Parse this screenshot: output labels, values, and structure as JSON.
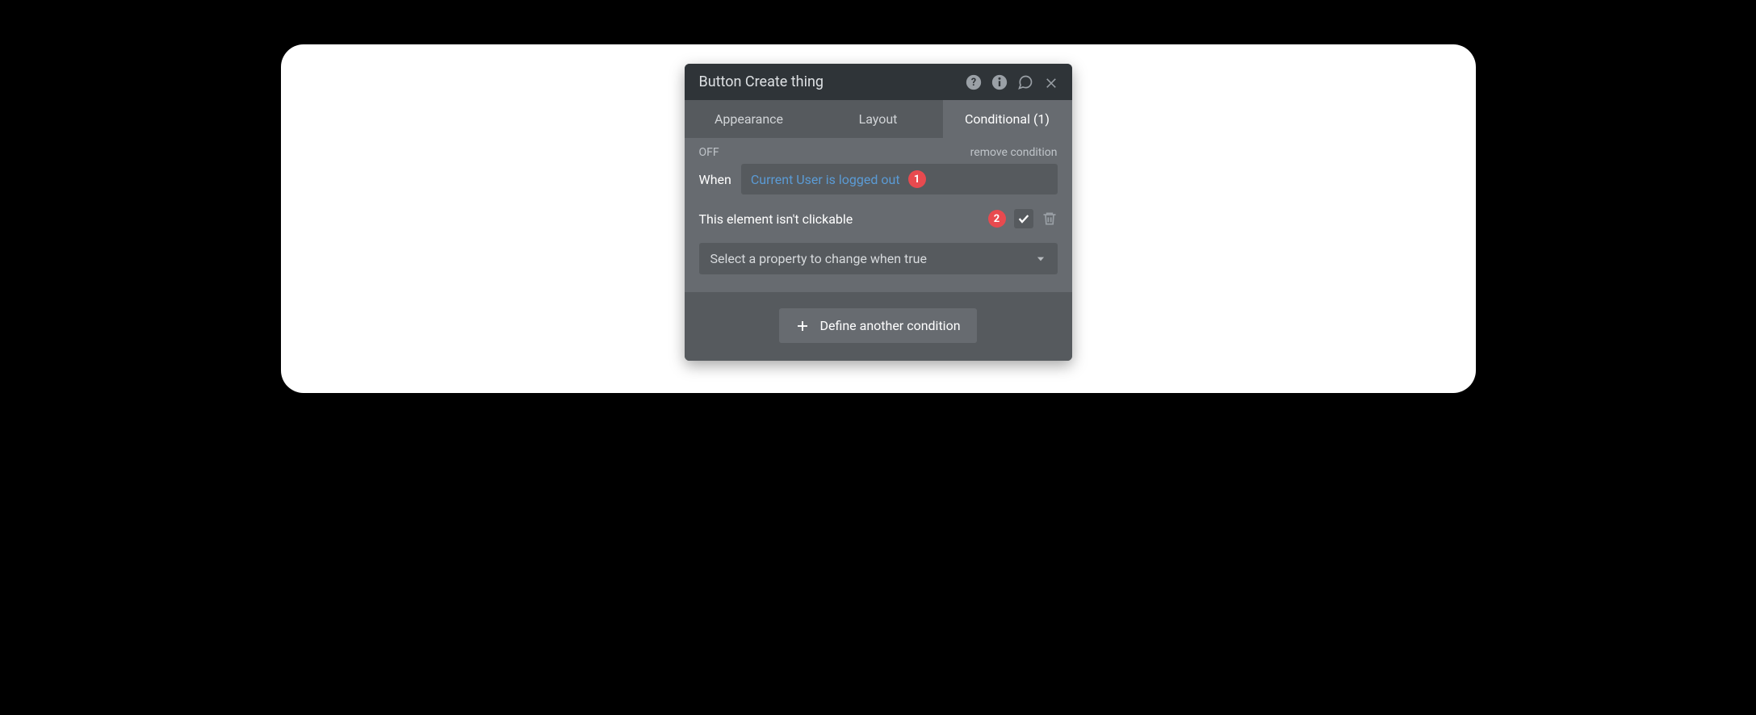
{
  "header": {
    "title": "Button Create thing"
  },
  "tabs": {
    "appearance": "Appearance",
    "layout": "Layout",
    "conditional": "Conditional (1)"
  },
  "condition": {
    "state_label": "OFF",
    "remove_label": "remove condition",
    "when_label": "When",
    "expression": "Current User is logged out",
    "badge1": "1",
    "property_label": "This element isn't clickable",
    "badge2": "2",
    "select_placeholder": "Select a property to change when true"
  },
  "footer": {
    "define_label": "Define another condition"
  }
}
